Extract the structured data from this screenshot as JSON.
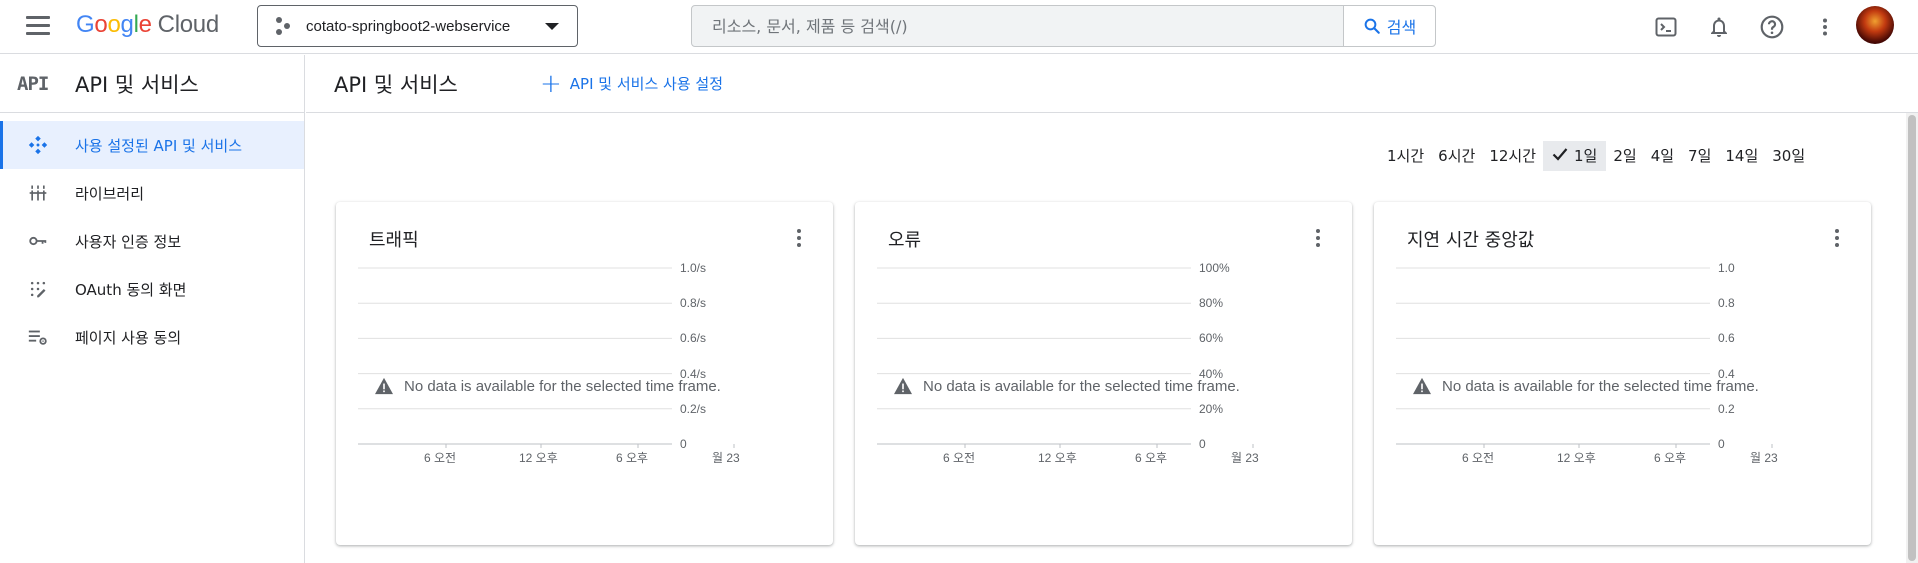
{
  "topbar": {
    "logo_google": "Google",
    "logo_cloud": "Cloud",
    "project_name": "cotato-springboot2-webservice",
    "search_placeholder": "리소스, 문서, 제품 등 검색(/)",
    "search_button": "검색"
  },
  "sidebar": {
    "glyph": "API",
    "title": "API 및 서비스",
    "items": [
      {
        "label": "사용 설정된 API 및 서비스",
        "icon": "api-diamond-icon",
        "active": true
      },
      {
        "label": "라이브러리",
        "icon": "library-icon",
        "active": false
      },
      {
        "label": "사용자 인증 정보",
        "icon": "key-icon",
        "active": false
      },
      {
        "label": "OAuth 동의 화면",
        "icon": "consent-icon",
        "active": false
      },
      {
        "label": "페이지 사용 동의",
        "icon": "settings-list-icon",
        "active": false
      }
    ]
  },
  "main": {
    "title": "API 및 서비스",
    "enable_link": "API 및 서비스 사용 설정",
    "ranges": [
      "1시간",
      "6시간",
      "12시간",
      "1일",
      "2일",
      "4일",
      "7일",
      "14일",
      "30일"
    ],
    "selected_range": "1일",
    "nodata_message": "No data is available for the selected time frame."
  },
  "colors": {
    "accent": "#1a73e8",
    "active_bg": "#e8f0fe"
  },
  "chart_data": [
    {
      "type": "line",
      "title": "트래픽",
      "y_ticks": [
        "1.0/s",
        "0.8/s",
        "0.6/s",
        "0.4/s",
        "0.2/s",
        "0"
      ],
      "x_ticks": [
        "6 오전",
        "12 오후",
        "6 오후",
        "월 23"
      ],
      "series": []
    },
    {
      "type": "line",
      "title": "오류",
      "y_ticks": [
        "100%",
        "80%",
        "60%",
        "40%",
        "20%",
        "0"
      ],
      "x_ticks": [
        "6 오전",
        "12 오후",
        "6 오후",
        "월 23"
      ],
      "series": []
    },
    {
      "type": "line",
      "title": "지연 시간 중앙값",
      "y_ticks": [
        "1.0",
        "0.8",
        "0.6",
        "0.4",
        "0.2",
        "0"
      ],
      "x_ticks": [
        "6 오전",
        "12 오후",
        "6 오후",
        "월 23"
      ],
      "series": []
    }
  ]
}
